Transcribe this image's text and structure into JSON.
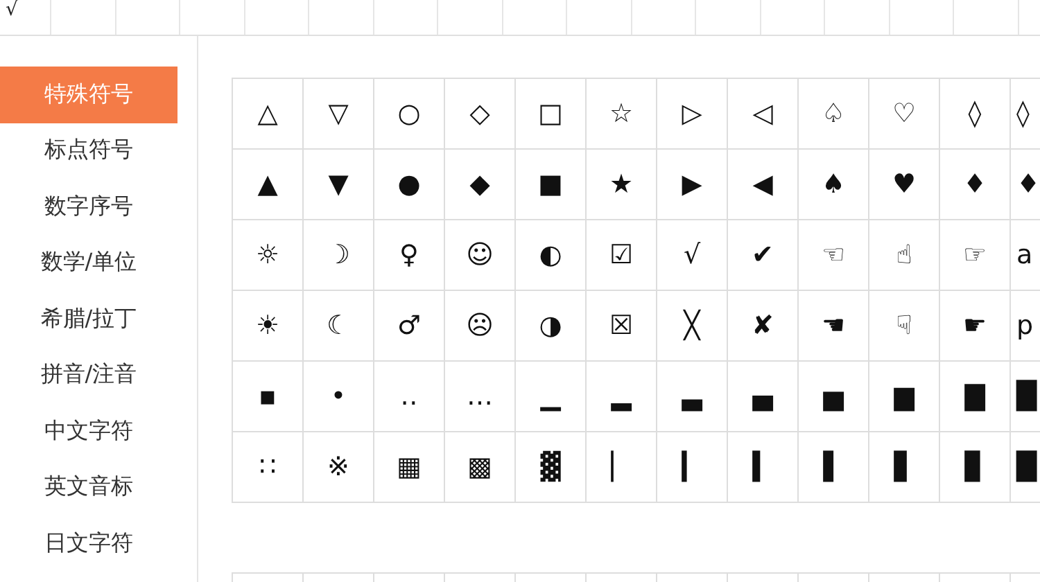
{
  "top_strip": {
    "first_cell": "√"
  },
  "sidebar": {
    "items": [
      {
        "label": "特殊符号",
        "selected": true
      },
      {
        "label": "标点符号",
        "selected": false
      },
      {
        "label": "数字序号",
        "selected": false
      },
      {
        "label": "数学/单位",
        "selected": false
      },
      {
        "label": "希腊/拉丁",
        "selected": false
      },
      {
        "label": "拼音/注音",
        "selected": false
      },
      {
        "label": "中文字符",
        "selected": false
      },
      {
        "label": "英文音标",
        "selected": false
      },
      {
        "label": "日文字符",
        "selected": false
      }
    ]
  },
  "symbol_grid": {
    "rows": [
      [
        "△",
        "▽",
        "○",
        "◇",
        "□",
        "☆",
        "▷",
        "◁",
        "♤",
        "♡",
        "◊",
        "◊"
      ],
      [
        "▲",
        "▼",
        "●",
        "◆",
        "■",
        "★",
        "▶",
        "◀",
        "♠",
        "♥",
        "♦",
        "♦"
      ],
      [
        "☼",
        "☽",
        "♀",
        "☺",
        "◐",
        "☑",
        "√",
        "✔",
        "☜",
        "☝",
        "☞",
        "a"
      ],
      [
        "☀",
        "☾",
        "♂",
        "☹",
        "◑",
        "☒",
        "╳",
        "✘",
        "☚",
        "☟",
        "☛",
        "p"
      ],
      [
        "▪",
        "•",
        "‥",
        "…",
        "▁",
        "▂",
        "▃",
        "▄",
        "▅",
        "▆",
        "▇",
        "█"
      ],
      [
        "∷",
        "※",
        "▦",
        "▩",
        "▓",
        "▏",
        "▎",
        "▍",
        "▌",
        "▋",
        "▊",
        "█"
      ]
    ]
  }
}
